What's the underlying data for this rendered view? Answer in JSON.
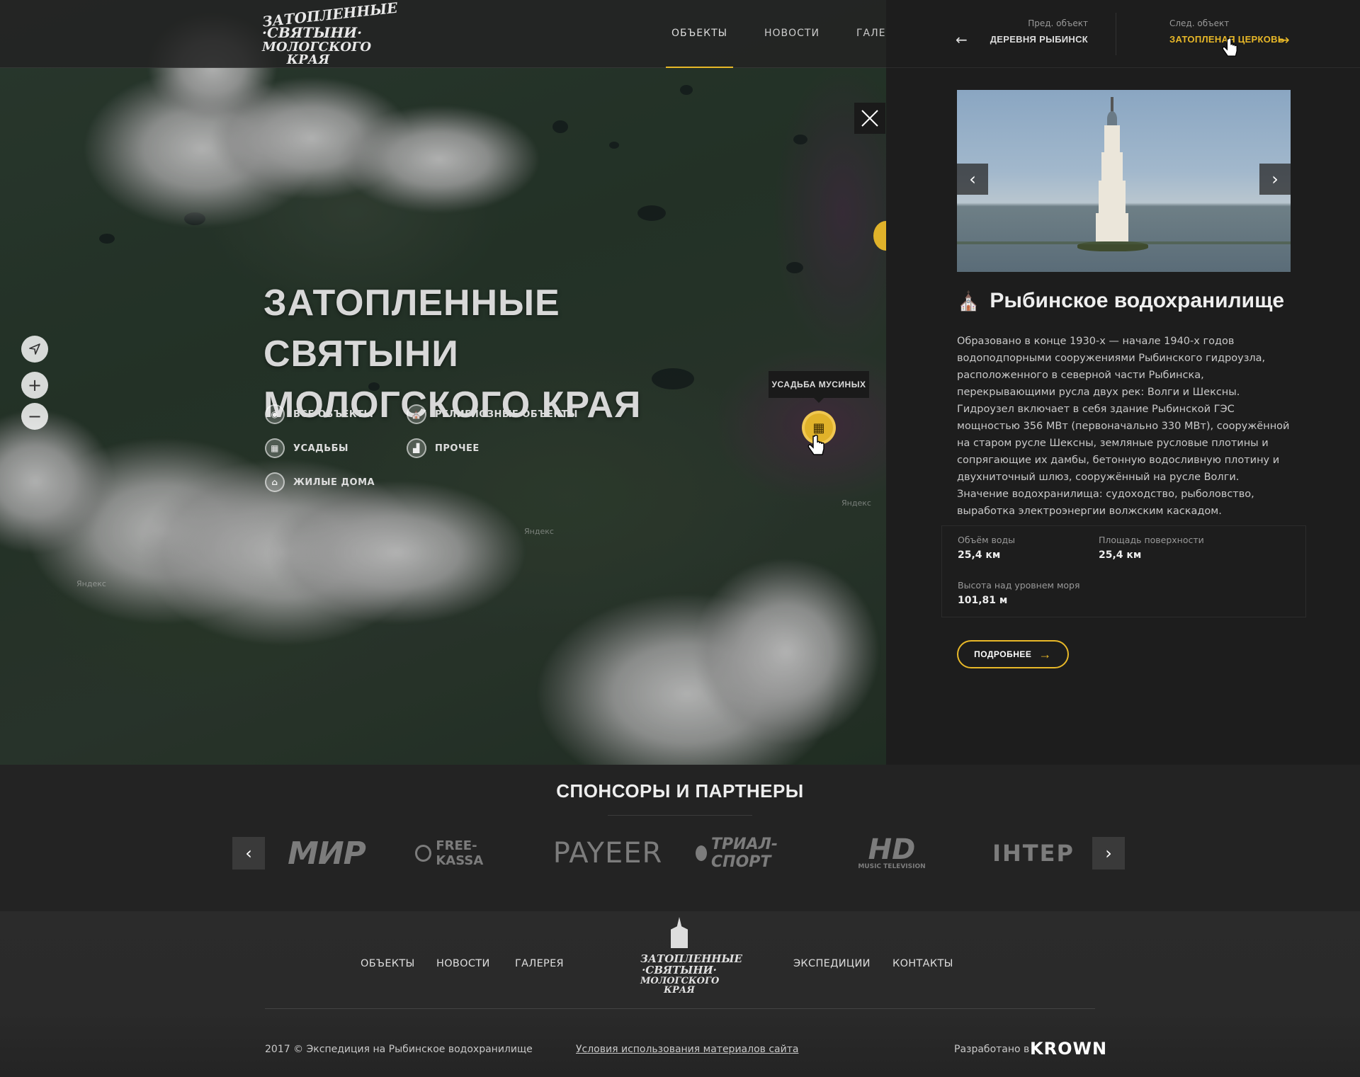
{
  "header": {
    "logo_lines": [
      "ЗАТОПЛЕННЫЕ",
      "·СВЯТЫНИ·",
      "МОЛОГСКОГО КРАЯ"
    ],
    "nav": [
      {
        "label": "ОБЪЕКТЫ",
        "active": true
      },
      {
        "label": "НОВОСТИ",
        "active": false
      },
      {
        "label": "ГАЛЕРЕЯ",
        "active": false
      }
    ]
  },
  "map": {
    "hero_title_line1": "ЗАТОПЛЕННЫЕ СВЯТЫНИ",
    "hero_title_line2": "МОЛОГСКОГО КРАЯ",
    "filters": [
      {
        "label": "ВСЕ ОБЪЕКТЫ",
        "icon": "pin-icon"
      },
      {
        "label": "РЕЛИГИОЗНЫЕ ОБЪЕКТЫ",
        "icon": "church-icon"
      },
      {
        "label": "УСАДЬБЫ",
        "icon": "manor-icon"
      },
      {
        "label": "ПРОЧЕЕ",
        "icon": "factory-icon"
      },
      {
        "label": "ЖИЛЫЕ ДОМА",
        "icon": "house-icon"
      }
    ],
    "tooltip": "УСАДЬБА МУСИНЫХ",
    "yandex_label": "Яндекс",
    "controls": [
      "locate-icon",
      "zoom-in-icon",
      "zoom-out-icon"
    ]
  },
  "panel": {
    "prev_caption": "Пред. объект",
    "prev_name": "ДЕРЕВНЯ РЫБИНСК",
    "next_caption": "След. объект",
    "next_name": "ЗАТОПЛЕНАЯ ЦЕРКОВЬ",
    "title": "Рыбинское водохранилище",
    "description": "Образовано в конце 1930-х — начале 1940-х годов водоподпорными сооружениями Рыбинского гидроузла, расположенного в северной части Рыбинска, перекрывающими русла двух рек: Волги и Шексны. Гидроузел включает в себя здание Рыбинской ГЭС мощностью 356 МВт (первоначально 330 МВт), сооружённой на старом русле Шексны, земляные русловые плотины и сопрягающие их дамбы, бетонную водосливную плотину и двухниточный шлюз, сооружённый на русле Волги. Значение водохранилища: судоходство, рыболовство, выработка электроэнергии волжским каскадом.",
    "stats": [
      {
        "label": "Объём воды",
        "value": "25,4 км"
      },
      {
        "label": "Площадь поверхности",
        "value": "25,4 км"
      },
      {
        "label": "Высота над уровнем моря",
        "value": "101,81 м"
      }
    ],
    "more_label": "ПОДРОБНЕЕ"
  },
  "sponsors": {
    "title": "СПОНСОРЫ И ПАРТНЕРЫ",
    "logos": [
      "МИР",
      "FREE-KASSA",
      "PAYEER",
      "ТРИАЛ-СПОРТ",
      "HD",
      "ІНТЕР"
    ],
    "hd_caption": "MUSIC TELEVISION"
  },
  "footer": {
    "nav_left": [
      "ОБЪЕКТЫ",
      "НОВОСТИ",
      "ГАЛЕРЕЯ"
    ],
    "nav_right": [
      "ЭКСПЕДИЦИИ",
      "КОНТАКТЫ"
    ],
    "logo_lines": [
      "ЗАТОПЛЕННЫЕ",
      "·СВЯТЫНИ·",
      "МОЛОГСКОГО КРАЯ"
    ],
    "copyright": "2017 © Экспедиция на Рыбинское водохранилище",
    "terms": "Условия использования материалов сайта",
    "developed_by": "Разработано в",
    "brand": "KROWN"
  },
  "colors": {
    "accent": "#e8b828",
    "panel_bg": "#1d1d1d",
    "footer_bg": "#2a2a2a"
  }
}
